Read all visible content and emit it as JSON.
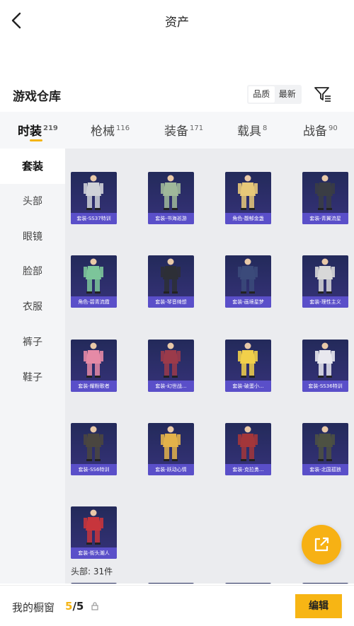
{
  "header": {
    "title": "资产",
    "back_icon": "chevron-left-icon"
  },
  "warehouse": {
    "title": "游戏仓库",
    "sort_options": [
      "品质",
      "最新"
    ],
    "selected_sort": "品质",
    "filter_icon": "filter-icon"
  },
  "tabs": [
    {
      "label": "时装",
      "count": "219",
      "active": true
    },
    {
      "label": "枪械",
      "count": "116",
      "active": false
    },
    {
      "label": "装备",
      "count": "171",
      "active": false
    },
    {
      "label": "载具",
      "count": "8",
      "active": false
    },
    {
      "label": "战备",
      "count": "90",
      "active": false
    }
  ],
  "sidebar": {
    "items": [
      "套装",
      "头部",
      "眼镜",
      "脸部",
      "衣服",
      "裤子",
      "鞋子"
    ],
    "active": "套装"
  },
  "items": [
    {
      "name": "套装-SS37特训",
      "color": "#cfd2d8"
    },
    {
      "name": "套装-书海巡游",
      "color": "#9fb89a"
    },
    {
      "name": "角色-馥郁金盏",
      "color": "#e7c879"
    },
    {
      "name": "套装-青翼流星",
      "color": "#3a3d44"
    },
    {
      "name": "角色-碧青流霞",
      "color": "#7cc59a"
    },
    {
      "name": "套装-琴音绮想",
      "color": "#2d2f36"
    },
    {
      "name": "套装-画境星梦",
      "color": "#3b4a7a"
    },
    {
      "name": "套装-理性主义",
      "color": "#d8d8d8"
    },
    {
      "name": "套装-耀粉歌者",
      "color": "#e58aa6"
    },
    {
      "name": "套装-幻世战...",
      "color": "#9b3a4a"
    },
    {
      "name": "套装-破蛋小...",
      "color": "#f2d04a"
    },
    {
      "name": "套装-SS36特训",
      "color": "#e8e8ee"
    },
    {
      "name": "套装-SS6特训",
      "color": "#4a4640"
    },
    {
      "name": "套装-跃动心情",
      "color": "#e3b24a"
    },
    {
      "name": "套装-克拉勇...",
      "color": "#a3363a"
    },
    {
      "name": "套装-北国孤狼",
      "color": "#4d5142"
    },
    {
      "name": "套装-街头潮人",
      "color": "#c7353c"
    }
  ],
  "next_section": {
    "label": "头部: 31件"
  },
  "fab": {
    "icon": "share-out-icon"
  },
  "showcase": {
    "label": "我的橱窗",
    "used": "5",
    "total": "/5",
    "lock_icon": "lock-icon",
    "edit_label": "编辑"
  }
}
